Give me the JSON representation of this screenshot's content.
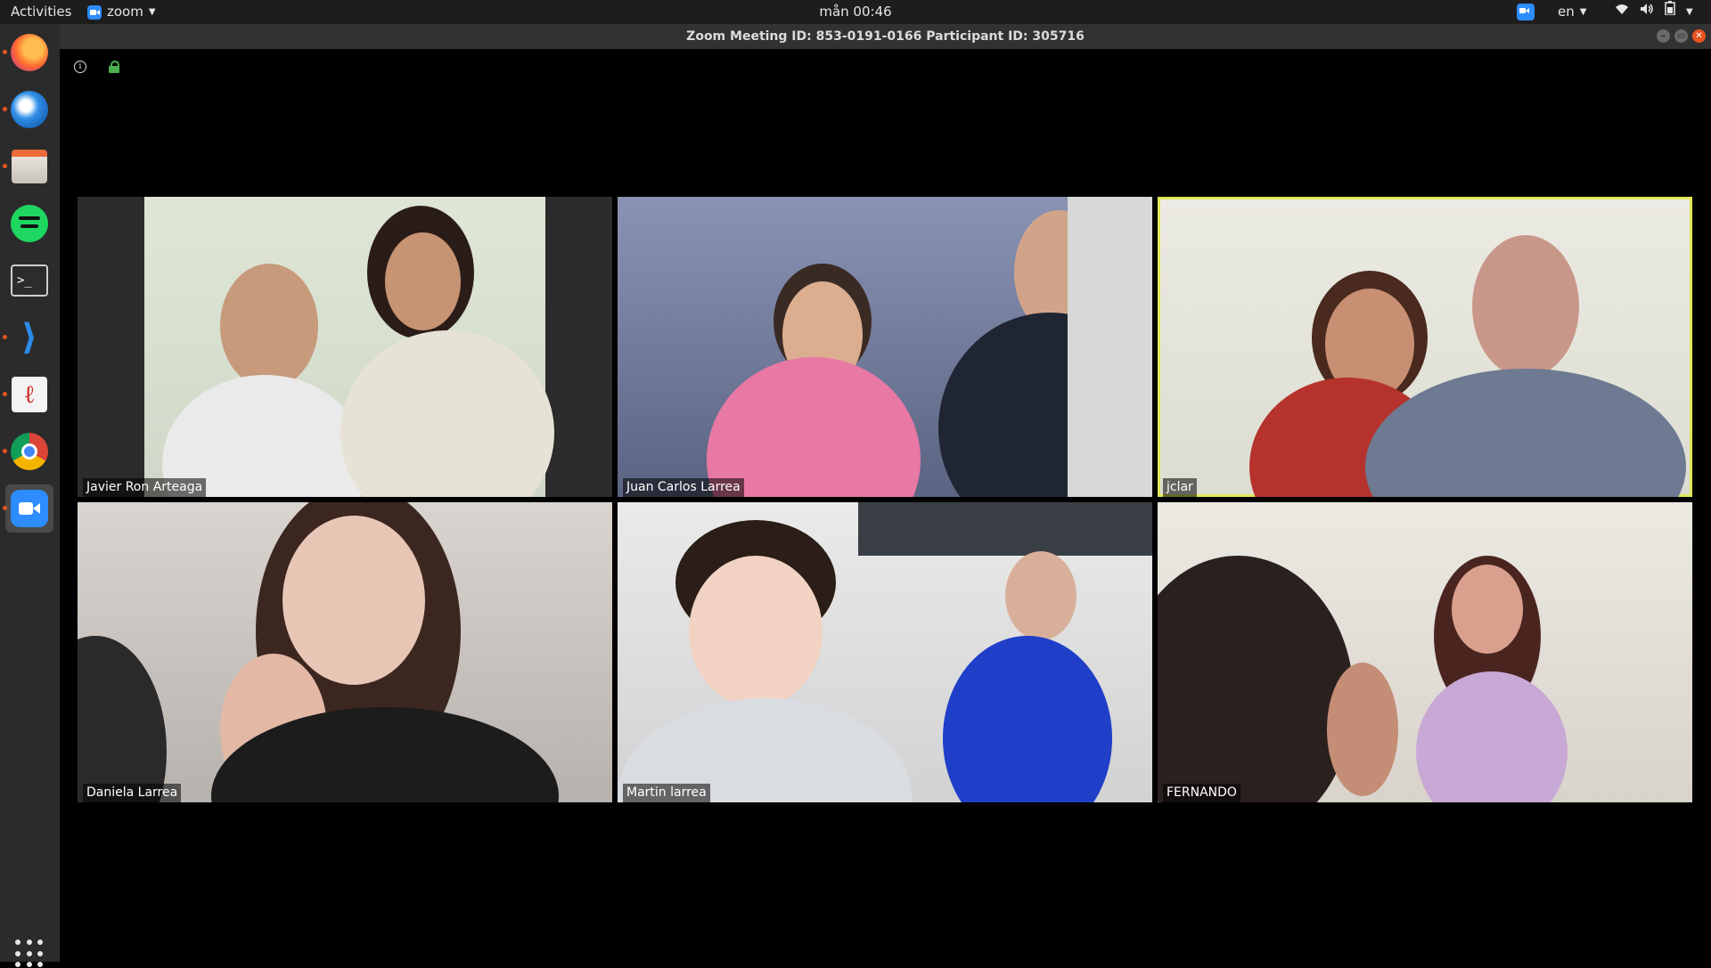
{
  "topbar": {
    "activities": "Activities",
    "app_name": "zoom",
    "clock": "mån 00:46",
    "language": "en"
  },
  "dock": {
    "items": [
      {
        "icon": "firefox-icon",
        "running": true
      },
      {
        "icon": "thunderbird-icon",
        "running": true
      },
      {
        "icon": "files-icon",
        "running": true
      },
      {
        "icon": "spotify-icon",
        "running": false
      },
      {
        "icon": "terminal-icon",
        "running": false
      },
      {
        "icon": "vscode-icon",
        "running": true
      },
      {
        "icon": "text-editor-icon",
        "running": true
      },
      {
        "icon": "chrome-icon",
        "running": true
      },
      {
        "icon": "zoom-icon",
        "running": true,
        "active": true
      }
    ],
    "apps_grid_icon": "show-applications-icon"
  },
  "window": {
    "title": "Zoom Meeting ID: 853-0191-0166 Participant ID: 305716"
  },
  "participants": [
    {
      "name": "Javier Ron Arteaga",
      "speaking": false
    },
    {
      "name": "Juan Carlos Larrea",
      "speaking": false
    },
    {
      "name": "jclar",
      "speaking": true
    },
    {
      "name": "Daniela Larrea",
      "speaking": false
    },
    {
      "name": "Martin larrea",
      "speaking": false
    },
    {
      "name": "FERNANDO",
      "speaking": false
    }
  ],
  "colors": {
    "speaking_border": "#e3e85a",
    "topbar_bg": "#1d1d1d",
    "dock_bg": "#2b2b2b",
    "running_indicator": "#e95420"
  }
}
